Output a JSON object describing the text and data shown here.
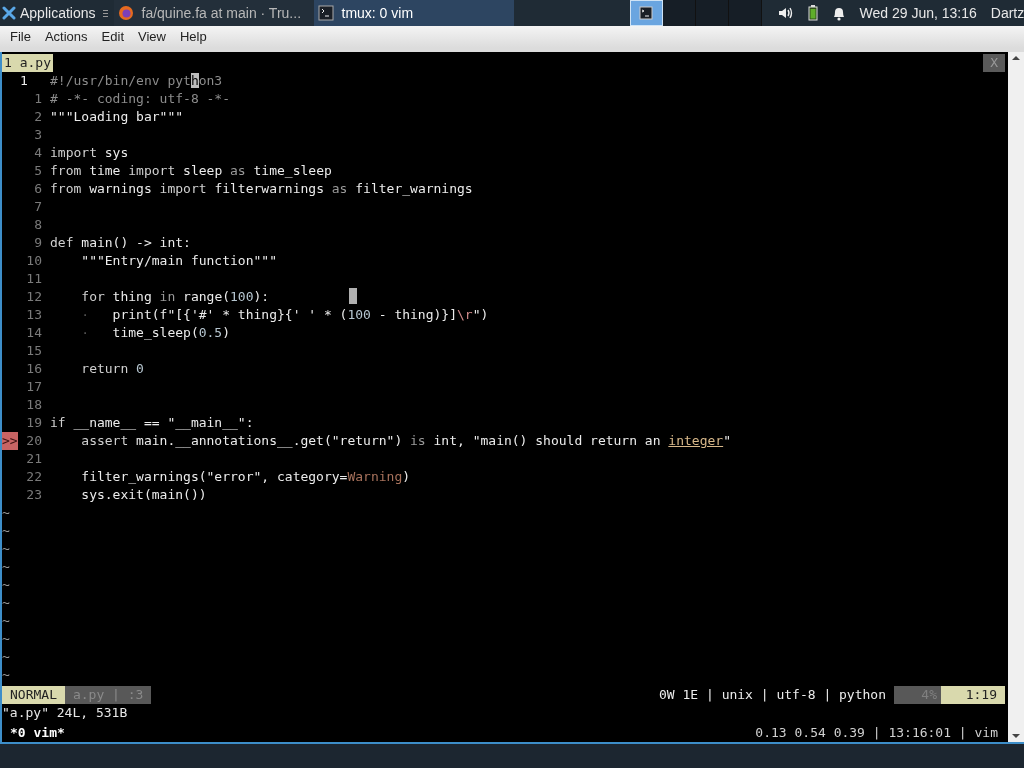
{
  "panel": {
    "applications": "Applications",
    "tasks": [
      {
        "label": "fa/quine.fa at main · Tru...",
        "kind": "browser",
        "selected": false
      },
      {
        "label": "tmux: 0 vim",
        "kind": "terminal",
        "selected": true
      }
    ],
    "workspaces": [
      {
        "selected": true
      },
      {
        "selected": false
      },
      {
        "selected": false
      },
      {
        "selected": false
      }
    ],
    "clock": "Wed 29 Jun, 13:16",
    "user": "Dartz"
  },
  "menu_bar": [
    "File",
    "Actions",
    "Edit",
    "View",
    "Help"
  ],
  "tmux_tab": {
    "label": "1 a.py",
    "close": "X"
  },
  "editor": {
    "lines": [
      {
        "number": "1",
        "current": true,
        "segments": [
          {
            "text": "#!/usr/bin/env pyt",
            "kind": "comment"
          },
          {
            "text": "h",
            "kind": "cursor"
          },
          {
            "text": "on3",
            "kind": "comment"
          }
        ]
      },
      {
        "number": "1",
        "current": false,
        "segments": [
          {
            "text": "# -*- coding: utf-8 -*-",
            "kind": "comment"
          }
        ]
      },
      {
        "number": "2",
        "current": false,
        "segments": [
          {
            "text": "\"\"\"Loading bar\"\"\"",
            "kind": "text"
          }
        ]
      },
      {
        "number": "3",
        "current": false
      },
      {
        "number": "4",
        "current": false,
        "segments": [
          {
            "text": "import",
            "kind": "keyword"
          },
          {
            "text": " sys",
            "kind": "text"
          }
        ]
      },
      {
        "number": "5",
        "current": false,
        "segments": [
          {
            "text": "from",
            "kind": "keyword"
          },
          {
            "text": " time ",
            "kind": "text"
          },
          {
            "text": "import",
            "kind": "keyword"
          },
          {
            "text": " sleep ",
            "kind": "text"
          },
          {
            "text": "as",
            "kind": "op"
          },
          {
            "text": " time_sleep",
            "kind": "text"
          }
        ]
      },
      {
        "number": "6",
        "current": false,
        "segments": [
          {
            "text": "from",
            "kind": "keyword"
          },
          {
            "text": " warnings ",
            "kind": "text"
          },
          {
            "text": "import",
            "kind": "keyword"
          },
          {
            "text": " filterwarnings ",
            "kind": "text"
          },
          {
            "text": "as",
            "kind": "op"
          },
          {
            "text": " filter_warnings",
            "kind": "text"
          }
        ]
      },
      {
        "number": "7",
        "current": false
      },
      {
        "number": "8",
        "current": false
      },
      {
        "number": "9",
        "current": false,
        "segments": [
          {
            "text": "def",
            "kind": "keyword"
          },
          {
            "text": " main() -> int:",
            "kind": "text"
          }
        ]
      },
      {
        "number": "10",
        "current": false,
        "segments": [
          {
            "text": "    \"\"\"Entry/main function\"\"\"",
            "kind": "text"
          }
        ]
      },
      {
        "number": "11",
        "current": false
      },
      {
        "number": "12",
        "current": false,
        "segments": [
          {
            "text": "    for",
            "kind": "keyword"
          },
          {
            "text": " thing ",
            "kind": "text"
          },
          {
            "text": "in",
            "kind": "op"
          },
          {
            "text": " range(",
            "kind": "text"
          },
          {
            "text": "100",
            "kind": "number"
          },
          {
            "text": "):",
            "kind": "text"
          }
        ]
      },
      {
        "number": "13",
        "current": false,
        "segments": [
          {
            "text": "    ·",
            "kind": "whitespace"
          },
          {
            "text": "   print(f\"[{'#' * thing}{' ' * (",
            "kind": "text"
          },
          {
            "text": "100",
            "kind": "number"
          },
          {
            "text": " - thing)}]",
            "kind": "text"
          },
          {
            "text": "\\r",
            "kind": "escape"
          },
          {
            "text": "\")",
            "kind": "text"
          }
        ]
      },
      {
        "number": "14",
        "current": false,
        "segments": [
          {
            "text": "    ·",
            "kind": "whitespace"
          },
          {
            "text": "   time_sleep(",
            "kind": "text"
          },
          {
            "text": "0.5",
            "kind": "number"
          },
          {
            "text": ")",
            "kind": "text"
          }
        ]
      },
      {
        "number": "15",
        "current": false
      },
      {
        "number": "16",
        "current": false,
        "segments": [
          {
            "text": "    return",
            "kind": "keyword"
          },
          {
            "text": " 0",
            "kind": "number"
          }
        ]
      },
      {
        "number": "17",
        "current": false
      },
      {
        "number": "18",
        "current": false
      },
      {
        "number": "19",
        "current": false,
        "segments": [
          {
            "text": "if",
            "kind": "keyword"
          },
          {
            "text": " __name__ == \"__main__\":",
            "kind": "text"
          }
        ]
      },
      {
        "number": "20",
        "current": false,
        "sign": ">>",
        "segments": [
          {
            "text": "    assert",
            "kind": "keyword"
          },
          {
            "text": " main.__annotations__.get(\"return\") ",
            "kind": "text"
          },
          {
            "text": "is",
            "kind": "op"
          },
          {
            "text": " int, \"main() should return an ",
            "kind": "text"
          },
          {
            "text": "integer",
            "kind": "spell"
          },
          {
            "text": "\"",
            "kind": "text"
          }
        ]
      },
      {
        "number": "21",
        "current": false
      },
      {
        "number": "22",
        "current": false,
        "segments": [
          {
            "text": "    filter_warnings(\"error\", category=",
            "kind": "text"
          },
          {
            "text": "Warning",
            "kind": "type"
          },
          {
            "text": ")",
            "kind": "text"
          }
        ]
      },
      {
        "number": "23",
        "current": false,
        "segments": [
          {
            "text": "    sys.exit(main())",
            "kind": "text"
          }
        ]
      }
    ],
    "tildes": [
      "~",
      "~",
      "~",
      "~",
      "~",
      "~",
      "~",
      "~",
      "~",
      "~"
    ]
  },
  "status_line": {
    "mode": "NORMAL",
    "file_info": "a.py | :3",
    "file_format": "0W 1E | unix | utf-8 | python",
    "percent": "4%",
    "position": "1:19"
  },
  "message": "\"a.py\" 24L, 531B",
  "tmux_status": {
    "left": "*0 vim*",
    "right": "0.13 0.54 0.39 | 13:16:01 | vim"
  }
}
